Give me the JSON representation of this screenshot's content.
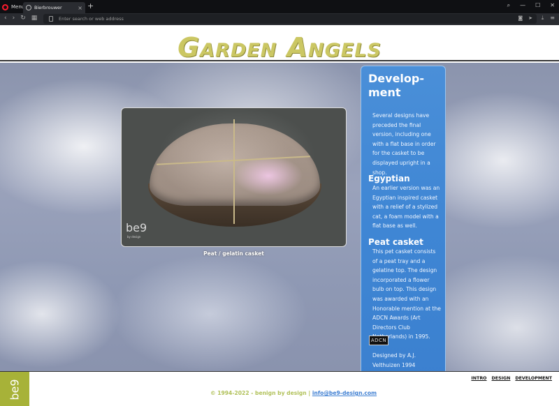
{
  "browser": {
    "menu_label": "Menu",
    "tab_title": "Bierbrouwer",
    "address_placeholder": "Enter search or web address"
  },
  "site": {
    "logo": "Garden Angels"
  },
  "main": {
    "photo_watermark": "be9",
    "photo_watermark_sub": "by design",
    "caption": "Peat / gelatin casket"
  },
  "panel": {
    "title": "Develop-ment",
    "intro": "Several designs have preceded the final version, including one with a flat base in order for the casket to be displayed upright in a shop.",
    "egyptian_heading": "Egyptian",
    "egyptian_text": "An earlier version was an Egyptian inspired casket with a relief of a stylized cat, a foam model with a flat base as well.",
    "peat_heading": "Peat casket",
    "peat_text": "This pet casket consists of a peat tray and a gelatine top. The design incorporated a flower bulb on top. This design was awarded with an Honorable mention at the ADCN Awards (Art Directors Club Netherlands) in 1995.",
    "adcn_badge": "ADCN",
    "credit": "Designed by A.J. Velthuizen 1994"
  },
  "footer": {
    "logo": "be9",
    "nav": [
      "INTRO",
      "DESIGN",
      "DEVELOPMENT"
    ],
    "copyright": "© 1994-2022 - benign by design",
    "separator": "|",
    "email": "info@be9-design.com"
  },
  "colors": {
    "logo": "#cbc763",
    "panel": "#4a8fd8",
    "footer_logo": "#a7b238",
    "link": "#3f7fd2"
  }
}
